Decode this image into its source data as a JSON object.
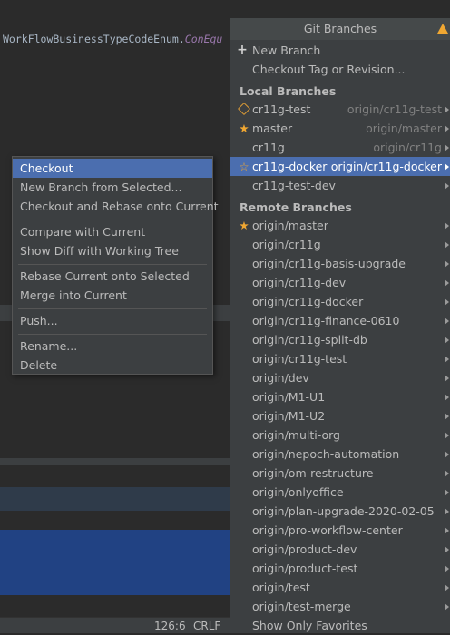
{
  "editor": {
    "code_text": "WorkFlowBusinessTypeCodeEnum.",
    "code_italic": "ConEqu"
  },
  "status": {
    "position": "126:6",
    "line_ending": "CRLF"
  },
  "context_menu": {
    "checkout": "Checkout",
    "new_branch_from_selected": "New Branch from Selected...",
    "checkout_rebase": "Checkout and Rebase onto Current",
    "compare": "Compare with Current",
    "show_diff": "Show Diff with Working Tree",
    "rebase": "Rebase Current onto Selected",
    "merge": "Merge into Current",
    "push": "Push...",
    "rename": "Rename...",
    "delete": "Delete"
  },
  "git": {
    "title": "Git Branches",
    "new_branch": "New Branch",
    "checkout_tag": "Checkout Tag or Revision...",
    "local_header": "Local Branches",
    "local": [
      {
        "name": "cr11g-test",
        "remote": "origin/cr11g-test",
        "icon": "tag-icon"
      },
      {
        "name": "master",
        "remote": "origin/master",
        "icon": "star-filled-icon"
      },
      {
        "name": "cr11g",
        "remote": "origin/cr11g",
        "icon": ""
      },
      {
        "name": "cr11g-docker",
        "remote": "origin/cr11g-docker",
        "icon": "star-outline-icon"
      },
      {
        "name": "cr11g-test-dev",
        "remote": "",
        "icon": ""
      }
    ],
    "remote_header": "Remote Branches",
    "remote": [
      "origin/master",
      "origin/cr11g",
      "origin/cr11g-basis-upgrade",
      "origin/cr11g-dev",
      "origin/cr11g-docker",
      "origin/cr11g-finance-0610",
      "origin/cr11g-split-db",
      "origin/cr11g-test",
      "origin/dev",
      "origin/M1-U1",
      "origin/M1-U2",
      "origin/multi-org",
      "origin/nepoch-automation",
      "origin/om-restructure",
      "origin/onlyoffice",
      "origin/plan-upgrade-2020-02-05",
      "origin/pro-workflow-center",
      "origin/product-dev",
      "origin/product-test",
      "origin/test",
      "origin/test-merge"
    ],
    "show_favorites": "Show Only Favorites"
  },
  "colors": {
    "selection": "#4b6eaf",
    "star": "#f0a732",
    "popup_bg": "#3c3f41"
  }
}
